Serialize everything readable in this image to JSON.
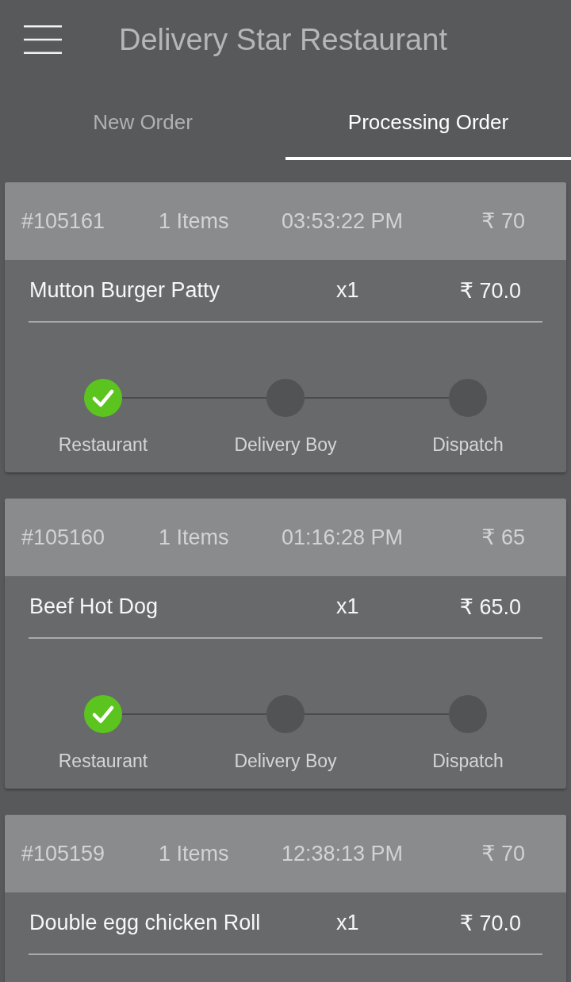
{
  "app_bar": {
    "title": "Delivery Star Restaurant"
  },
  "tabs": [
    {
      "label": "New Order",
      "selected": false
    },
    {
      "label": "Processing Order",
      "selected": true
    }
  ],
  "orders": [
    {
      "order_id": "#105161",
      "items_count": "1 Items",
      "time": "03:53:22 PM",
      "total": "₹ 70",
      "lines": [
        {
          "name": "Mutton Burger Patty",
          "qty": "x1",
          "price": "₹ 70.0"
        }
      ],
      "steps": [
        {
          "label": "Restaurant",
          "done": true
        },
        {
          "label": "Delivery Boy",
          "done": false
        },
        {
          "label": "Dispatch",
          "done": false
        }
      ]
    },
    {
      "order_id": "#105160",
      "items_count": "1 Items",
      "time": "01:16:28 PM",
      "total": "₹ 65",
      "lines": [
        {
          "name": "Beef Hot Dog",
          "qty": "x1",
          "price": "₹ 65.0"
        }
      ],
      "steps": [
        {
          "label": "Restaurant",
          "done": true
        },
        {
          "label": "Delivery Boy",
          "done": false
        },
        {
          "label": "Dispatch",
          "done": false
        }
      ]
    },
    {
      "order_id": "#105159",
      "items_count": "1 Items",
      "time": "12:38:13 PM",
      "total": "₹ 70",
      "lines": [
        {
          "name": "Double egg chicken Roll",
          "qty": "x1",
          "price": "₹ 70.0"
        }
      ]
    }
  ]
}
